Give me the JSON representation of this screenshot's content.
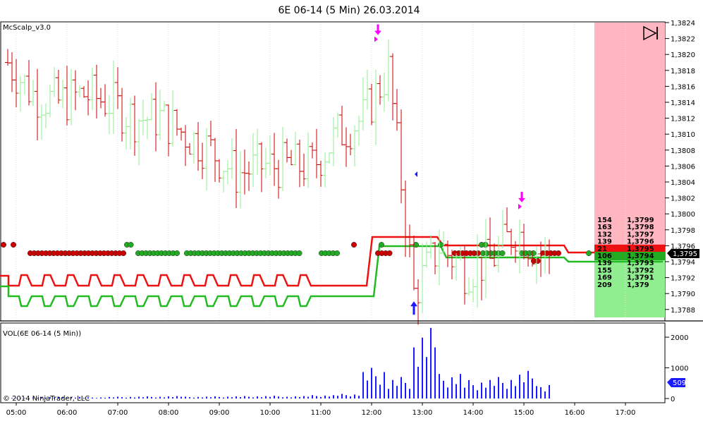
{
  "title": "6E 06-14 (5 Min)  26.03.2014",
  "price_panel": {
    "indicator_label": "McScalp_v3.0",
    "yticks": [
      "1,3824",
      "1,3822",
      "1,3820",
      "1,3818",
      "1,3816",
      "1,3814",
      "1,3812",
      "1,3810",
      "1,3808",
      "1,3806",
      "1,3804",
      "1,3802",
      "1,3800",
      "1,3798",
      "1,3796",
      "1,3794",
      "1,3792",
      "1,3790",
      "1,3788"
    ],
    "current_price_label": "1,3795"
  },
  "volume_panel": {
    "label": "VOL(6E 06-14 (5 Min))",
    "yticks": [
      "2000",
      "1000",
      "0"
    ],
    "current_volume_label": "509",
    "copyright": "© 2014 NinjaTrader, LLC"
  },
  "xticks": [
    "05:00",
    "06:00",
    "07:00",
    "08:00",
    "09:00",
    "10:00",
    "11:00",
    "12:00",
    "13:00",
    "14:00",
    "15:00",
    "16:00",
    "17:00"
  ],
  "dom_ladder": [
    {
      "qty": "154",
      "price": "1,3799",
      "side": "ask"
    },
    {
      "qty": "163",
      "price": "1,3798",
      "side": "ask"
    },
    {
      "qty": "132",
      "price": "1,3797",
      "side": "ask"
    },
    {
      "qty": "139",
      "price": "1,3796",
      "side": "ask"
    },
    {
      "qty": "21",
      "price": "1,3795",
      "side": "last"
    },
    {
      "qty": "106",
      "price": "1,3794",
      "side": "bid"
    },
    {
      "qty": "139",
      "price": "1,3793",
      "side": "bid"
    },
    {
      "qty": "155",
      "price": "1,3792",
      "side": "bid"
    },
    {
      "qty": "169",
      "price": "1,3791",
      "side": "bid"
    },
    {
      "qty": "209",
      "price": "1,379",
      "side": "bid"
    }
  ],
  "colors": {
    "up_bar": "#90ee90",
    "down_bar": "#cc0000",
    "upper_band": "#ee1111",
    "lower_band": "#22bb22",
    "volume": "#1a1aff",
    "ask_zone": "#ffb6c1",
    "bid_zone": "#90ee90",
    "last_price": "#ee1111",
    "signal": "#ff00ff"
  },
  "chart_data": {
    "type": "ohlc",
    "interval_minutes": 5,
    "x": [
      "05:00",
      "05:30",
      "06:00",
      "06:30",
      "07:00",
      "07:30",
      "08:00",
      "08:30",
      "09:00",
      "09:30",
      "10:00",
      "10:30",
      "11:00",
      "11:30",
      "12:00",
      "12:30",
      "13:00",
      "13:30",
      "14:00",
      "14:30",
      "15:00",
      "15:30"
    ],
    "price_close": [
      1.3819,
      1.3815,
      1.3814,
      1.3815,
      1.3814,
      1.3812,
      1.3812,
      1.381,
      1.3808,
      1.3805,
      1.3806,
      1.3806,
      1.3806,
      1.381,
      1.3812,
      1.3818,
      1.379,
      1.3796,
      1.3793,
      1.3794,
      1.3798,
      1.3795
    ],
    "last_price": 1.3795,
    "price_range": [
      1.3787,
      1.3824
    ],
    "volume": [
      20,
      40,
      50,
      40,
      60,
      70,
      80,
      60,
      70,
      80,
      90,
      80,
      110,
      150,
      1000,
      700,
      2300,
      800,
      600,
      700,
      900,
      509
    ],
    "volume_range": [
      0,
      2300
    ],
    "annotations": [
      {
        "type": "sell-arrow",
        "x": "12:05",
        "price": 1.3822
      },
      {
        "type": "buy-arrow",
        "x": "12:50",
        "price": 1.379
      },
      {
        "type": "sell-arrow",
        "x": "14:55",
        "price": 1.3801
      }
    ]
  }
}
